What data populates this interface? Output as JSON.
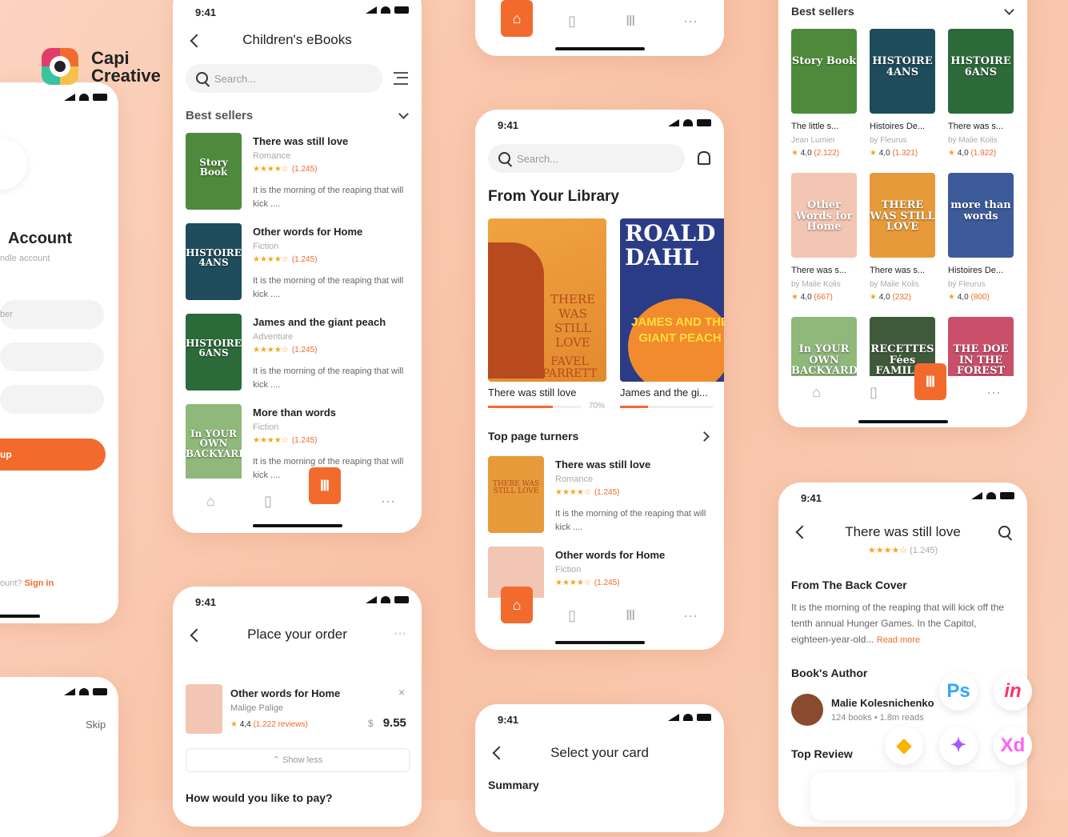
{
  "brand": {
    "line1": "Capi",
    "line2": "Creative"
  },
  "status_time": "9:41",
  "left_phone": {
    "title": "Account",
    "subtitle": "ndle account",
    "field1": "ber",
    "button": "up",
    "footer": "ount?",
    "signin": "Sign in"
  },
  "left_phone2": {
    "skip": "Skip"
  },
  "ebooks": {
    "title": "Children's eBooks",
    "search_placeholder": "Search...",
    "section": "Best sellers",
    "rows": [
      {
        "title": "There was still love",
        "genre": "Romance",
        "stars": "★★★★☆",
        "rating": "(1.245)",
        "desc": "It is the morning of the reaping that will kick ....",
        "cover": "Story Book",
        "color": "#4f8a3c"
      },
      {
        "title": "Other words for Home",
        "genre": "Fiction",
        "stars": "★★★★☆",
        "rating": "(1.245)",
        "desc": "It is the morning of the reaping that will kick ....",
        "cover": "HISTOIRE 4ANS",
        "color": "#1f4c5c"
      },
      {
        "title": "James and the giant peach",
        "genre": "Adventure",
        "stars": "★★★★☆",
        "rating": "(1.245)",
        "desc": "It is the morning of the reaping that will kick ....",
        "cover": "HISTOIRE 6ANS",
        "color": "#2d6a3a"
      },
      {
        "title": "More than words",
        "genre": "Fiction",
        "stars": "★★★★☆",
        "rating": "(1.245)",
        "desc": "It is the morning of the reaping that will kick ....",
        "cover": "In YOUR OWN BACKYARD",
        "color": "#8fb87a"
      }
    ]
  },
  "order": {
    "title": "Place your order",
    "item_title": "Other words for Home",
    "item_author": "Malige Palige",
    "item_rating": "4,4",
    "item_reviews": "(1.222 reviews)",
    "currency": "$",
    "price": "9.55",
    "show_less": "Show less",
    "pay_q": "How would you like to pay?"
  },
  "library": {
    "search_placeholder": "Search...",
    "heading": "From Your Library",
    "books": [
      {
        "title": "There was still love",
        "progress": "70%",
        "progress_value": 0.7
      },
      {
        "title": "James and the gi...",
        "progress_value": 0.3
      }
    ],
    "cover1": "THERE WAS STILL LOVE",
    "cover1_author": "FAVEL PARRETT",
    "cover2_top": "ROALD DAHL",
    "cover2_main": "JAMES AND THE GIANT PEACH",
    "turners_title": "Top page turners",
    "turners": [
      {
        "title": "There was still love",
        "genre": "Romance",
        "stars": "★★★★☆",
        "rating": "(1.245)",
        "desc": "It is the morning of the reaping that will kick ....",
        "cover": "THERE WAS STILL LOVE",
        "color": "#e69a3a"
      },
      {
        "title": "Other words for Home",
        "genre": "Fiction",
        "stars": "★★★★☆",
        "rating": "(1.245)",
        "cover": "",
        "color": "#f2c6b2"
      }
    ]
  },
  "card": {
    "title": "Select your card",
    "summary": "Summary"
  },
  "bestsellers": {
    "title": "Best sellers",
    "items": [
      {
        "title": "The little s...",
        "author": "Jean Lumier",
        "rating": "4,0",
        "count": "(2.122)",
        "cover": "Story Book",
        "color": "#4f8a3c"
      },
      {
        "title": "Histoires De...",
        "author": "by Fleurus",
        "rating": "4,0",
        "count": "(1.321)",
        "cover": "HISTOIRE 4ANS",
        "color": "#1f4c5c"
      },
      {
        "title": "There was s...",
        "author": "by Malie Kolis",
        "rating": "4,0",
        "count": "(1.922)",
        "cover": "HISTOIRE 6ANS",
        "color": "#2d6a3a"
      },
      {
        "title": "There was s...",
        "author": "by Malie Kolis",
        "rating": "4,0",
        "count": "(667)",
        "cover": "Other Words for Home",
        "color": "#f2c6b2"
      },
      {
        "title": "There was s...",
        "author": "by Malie Kolis",
        "rating": "4,0",
        "count": "(232)",
        "cover": "THERE WAS STILL LOVE",
        "color": "#e69a3a"
      },
      {
        "title": "Histoires De...",
        "author": "by Fleurus",
        "rating": "4,0",
        "count": "(800)",
        "cover": "more than words",
        "color": "#3d5a9a"
      },
      {
        "title": "",
        "author": "",
        "rating": "",
        "count": "",
        "cover": "In YOUR OWN BACKYARD",
        "color": "#8fb87a"
      },
      {
        "title": "",
        "author": "",
        "rating": "",
        "count": "",
        "cover": "RECETTES Fées FAMILLE",
        "color": "#3f5a3a"
      },
      {
        "title": "",
        "author": "",
        "rating": "",
        "count": "",
        "cover": "THE DOE IN THE FOREST",
        "color": "#c94f6a"
      }
    ]
  },
  "detail": {
    "title": "There was still love",
    "stars": "★★★★☆",
    "rating": "(1.245)",
    "back_cover_title": "From The Back Cover",
    "back_cover_text": "It is the morning of the reaping that will kick off the tenth annual Hunger Games. In the Capitol, eighteen-year-old...",
    "read_more": "Read more",
    "author_heading": "Book's Author",
    "author_name": "Malie Kolesnichenko",
    "author_books": "124 books",
    "author_reads": "1.8m reads",
    "top_review": "Top Review"
  },
  "tools": {
    "ps": "Ps",
    "inv": "in",
    "xd": "Xd"
  },
  "colors": {
    "accent": "#f26b2d",
    "background": "#f9c9b0",
    "star": "#f5a623"
  }
}
